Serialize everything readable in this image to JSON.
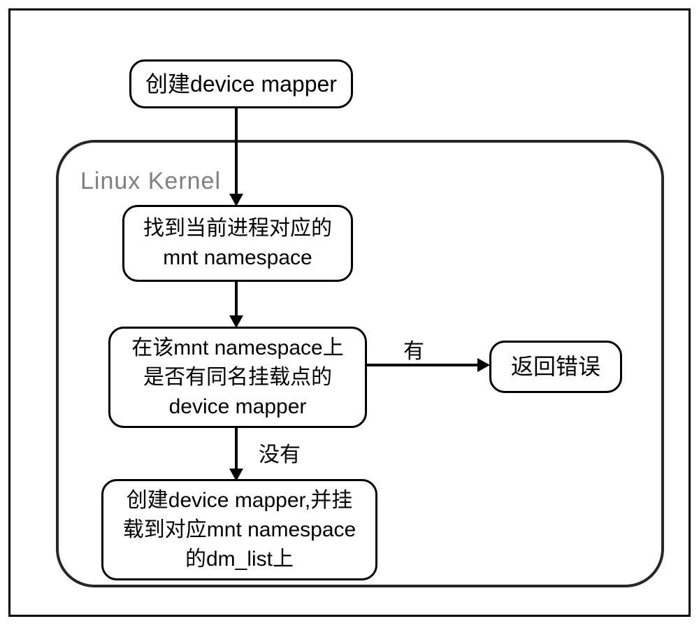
{
  "kernel_label": "Linux Kernel",
  "nodes": {
    "start": "创建device mapper",
    "find_ns": "找到当前进程对应的mnt namespace",
    "check_same": "在该mnt namespace上是否有同名挂载点的device mapper",
    "error": "返回错误",
    "create_mount": "创建device mapper,并挂载到对应mnt namespace的dm_list上"
  },
  "edges": {
    "yes": "有",
    "no": "没有"
  }
}
